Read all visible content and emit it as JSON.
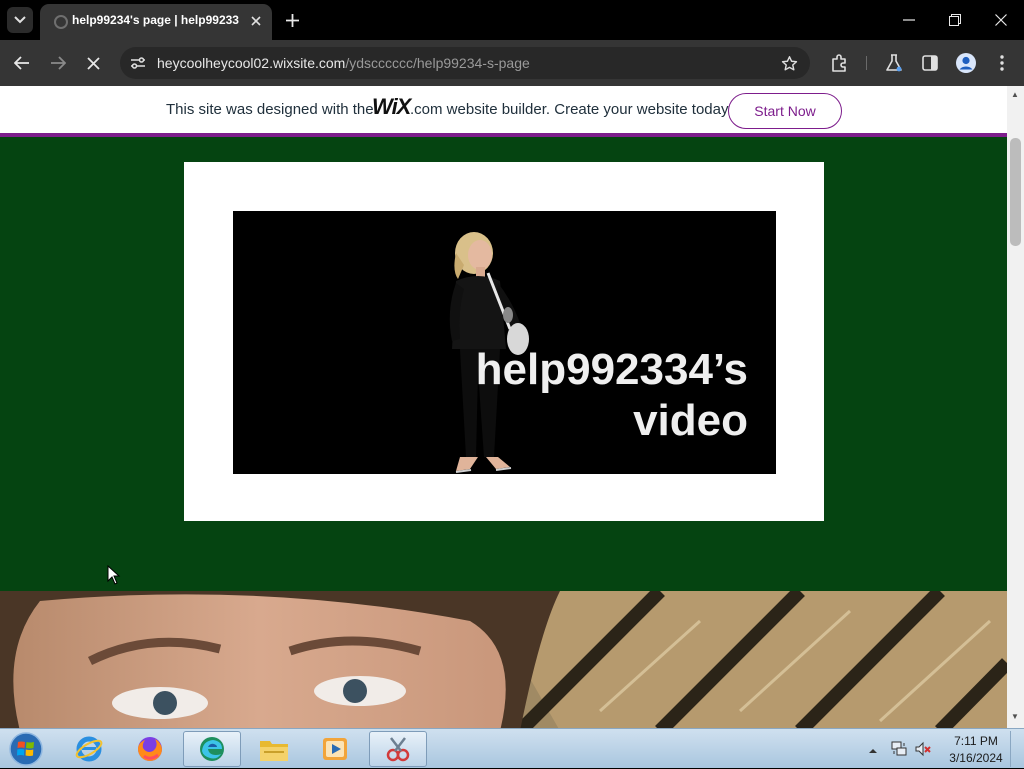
{
  "browser": {
    "tab": {
      "title": "help99234's page | help99233"
    },
    "url": {
      "host": "heycoolheycool02.wixsite.com",
      "path": "/ydscccccc/help99234-s-page"
    }
  },
  "wix_banner": {
    "text_before": "This site was designed with the",
    "logo_text": "WiX",
    "text_after": ".com website builder. Create your website today.",
    "cta_label": "Start Now"
  },
  "page": {
    "background_color": "#054411",
    "video": {
      "title_line1": "help992334’s",
      "title_line2": "video"
    }
  },
  "taskbar": {
    "apps": [
      "start-orb",
      "internet-explorer-icon",
      "firefox-icon",
      "edge-icon",
      "file-explorer-icon",
      "media-player-icon",
      "snipping-tool-icon"
    ],
    "clock": {
      "time": "7:11 PM",
      "date": "3/16/2024"
    }
  },
  "colors": {
    "wix_accent": "#7d1d8c",
    "browser_chrome": "#353535",
    "page_green": "#054411"
  }
}
